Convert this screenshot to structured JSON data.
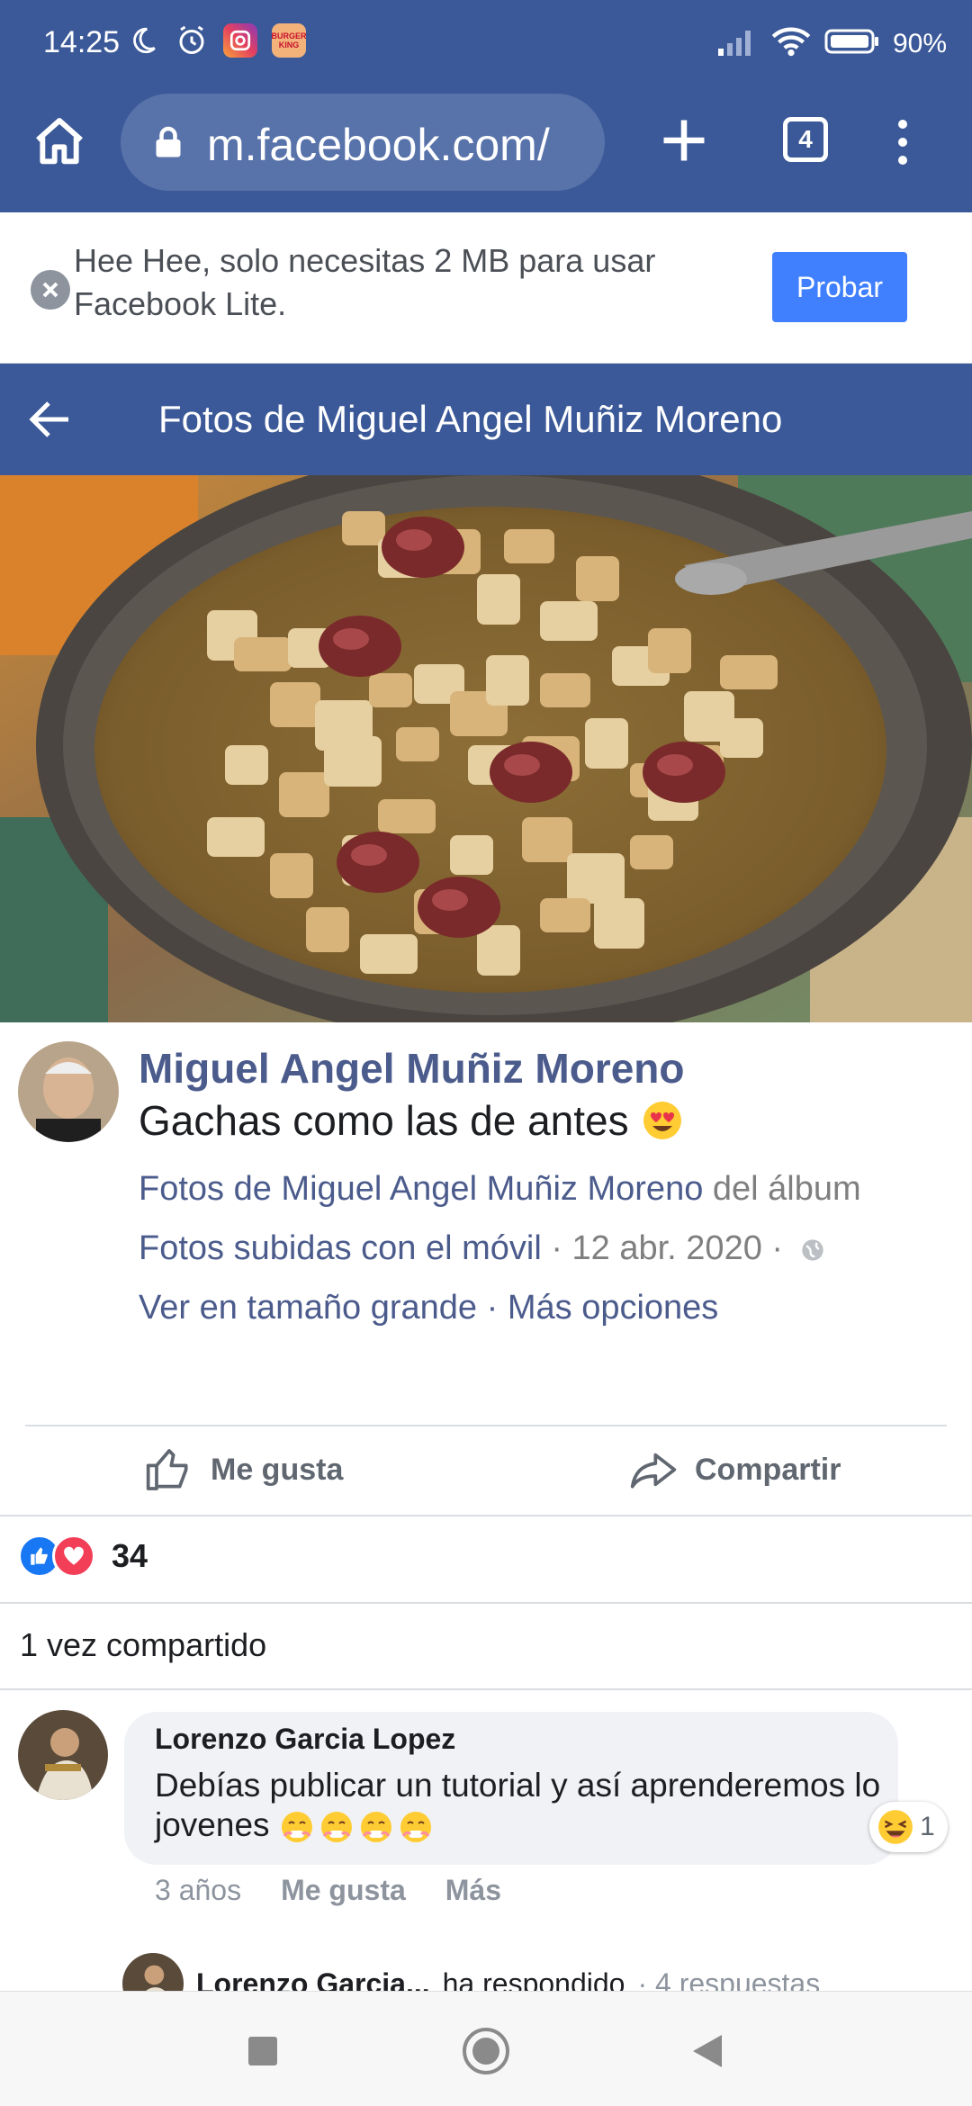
{
  "status_bar": {
    "time": "14:25",
    "battery": "90%",
    "icons": [
      "moon-icon",
      "alarm-icon",
      "instagram-icon",
      "burger-king-icon",
      "signal-icon",
      "wifi-icon",
      "battery-icon"
    ],
    "burger_king_label": "BURGER KING"
  },
  "browser": {
    "url": "m.facebook.com/",
    "tab_count": "4"
  },
  "lite_banner": {
    "text": "Hee Hee, solo necesitas 2 MB para usar Facebook Lite.",
    "button": "Probar"
  },
  "header": {
    "title": "Fotos de Miguel Angel Muñiz Moreno"
  },
  "post": {
    "author": "Miguel Angel Muñiz Moreno",
    "caption": "Gachas como las de antes",
    "album_link": "Fotos de Miguel Angel Muñiz Moreno",
    "album_word": " del álbum",
    "album_name": "Fotos subidas con el móvil",
    "date": " · 12 abr. 2020 ·",
    "view_large": "Ver en tamaño grande",
    "sep": " · ",
    "more_options": "Más opciones"
  },
  "actions": {
    "like": "Me gusta",
    "share": "Compartir"
  },
  "reactions": {
    "count": "34"
  },
  "shares": "1 vez compartido",
  "comment": {
    "author": "Lorenzo Garcia Lopez",
    "text": "Debías publicar un tutorial y así aprenderemos lo jovenes",
    "reaction_count": "1",
    "time": "3 años",
    "like": "Me gusta",
    "more": "Más"
  },
  "reply_preview": {
    "name": "Lorenzo Garcia...",
    "text": "ha respondido",
    "count": "· 4 respuestas"
  },
  "colors": {
    "facebook_blue": "#3b5998",
    "probar_blue": "#4080ff",
    "link": "#4b5b8c"
  }
}
